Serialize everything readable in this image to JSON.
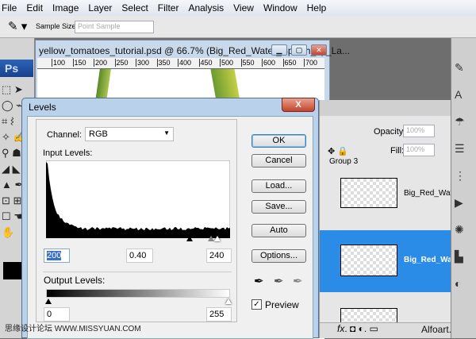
{
  "menu": [
    "File",
    "Edit",
    "Image",
    "Layer",
    "Select",
    "Filter",
    "Analysis",
    "View",
    "Window",
    "Help"
  ],
  "options_bar": {
    "tool_icon": "eyedropper-icon",
    "sample_size_label": "Sample Size:",
    "sample_size_value": "Point Sample"
  },
  "toolbox": {
    "logo": "Ps"
  },
  "document": {
    "title": "yellow_tomatoes_tutorial.psd @ 66.7% (Big_Red_Water_Splash_by_La...",
    "ruler": [
      "100",
      "150",
      "200",
      "250",
      "300",
      "350",
      "400",
      "450",
      "500",
      "550",
      "600",
      "650",
      "700"
    ]
  },
  "levels": {
    "title": "Levels",
    "close": "X",
    "channel_label": "Channel:",
    "channel_value": "RGB",
    "input_label": "Input Levels:",
    "input_black": "200",
    "input_gamma": "0.40",
    "input_white": "240",
    "output_label": "Output Levels:",
    "output_black": "0",
    "output_white": "255",
    "buttons": {
      "ok": "OK",
      "cancel": "Cancel",
      "load": "Load...",
      "save": "Save...",
      "auto": "Auto",
      "options": "Options..."
    },
    "preview_label": "Preview",
    "preview_checked": true
  },
  "layers": {
    "opacity_label": "Opacity:",
    "opacity_value": "100%",
    "fill_label": "Fill:",
    "fill_value": "100%",
    "group": "Group 3",
    "items": [
      {
        "name": "Big_Red_Water...",
        "selected": false
      },
      {
        "name": "Big_Red_Wa...",
        "selected": true
      }
    ],
    "selected_color": "#2b8ce8"
  },
  "watermarks": {
    "left": "思缘设计论坛 WWW.MISSYUAN.COM",
    "right": "Alfoart.com"
  }
}
